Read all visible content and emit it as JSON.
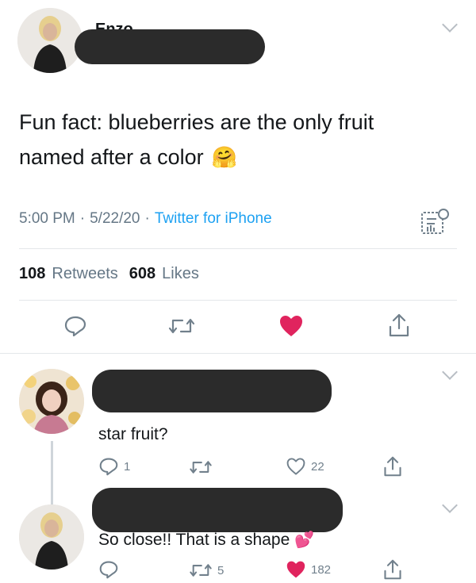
{
  "main_tweet": {
    "author_partial": "Enzo",
    "text_line1": "Fun fact: blueberries are the only fruit",
    "text_line2": "named after a color",
    "emoji": "🤗",
    "time": "5:00 PM",
    "date": "5/22/20",
    "source": "Twitter for iPhone",
    "separator": "·",
    "retweets_count": "108",
    "retweets_label": "Retweets",
    "likes_count": "608",
    "likes_label": "Likes",
    "accent_color": "#1da1f2",
    "like_color": "#e0245e"
  },
  "replies": [
    {
      "text": "star fruit?",
      "reply_count": "1",
      "retweet_count": "",
      "like_count": "22"
    },
    {
      "text": "So close!! That is a shape",
      "emoji": "💕",
      "reply_count": "",
      "retweet_count": "5",
      "like_count": "182"
    }
  ]
}
